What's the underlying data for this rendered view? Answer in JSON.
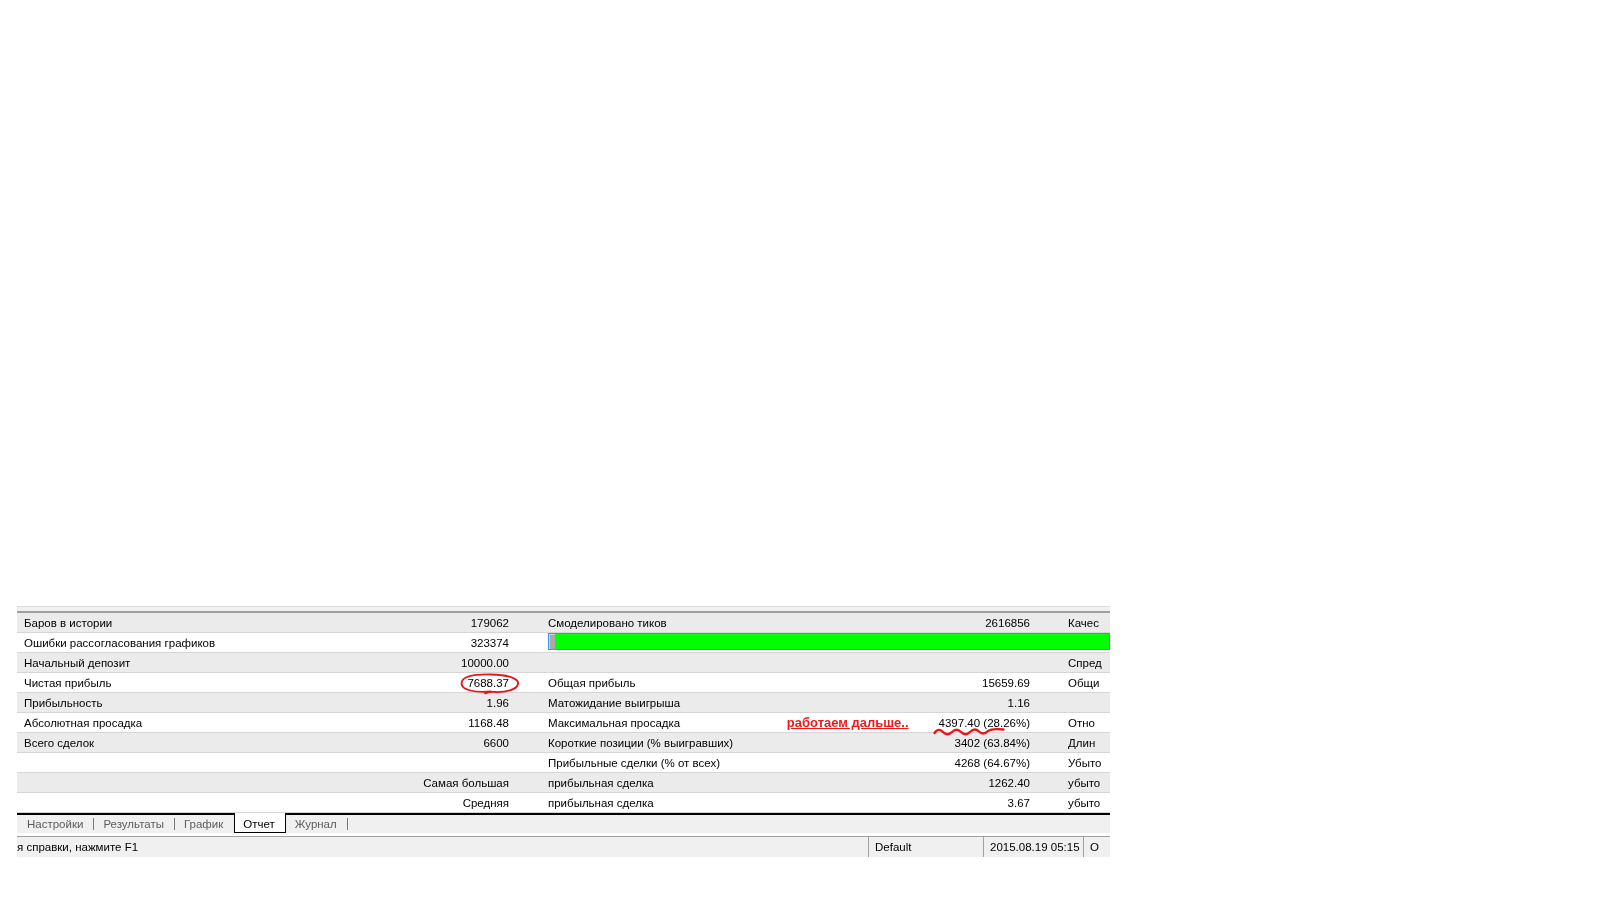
{
  "report": {
    "rows": [
      {
        "label": "Баров в истории",
        "value": "179062",
        "value_circled": false,
        "label_2": "Смоделировано тиков",
        "value_2": "2616856",
        "value_2_wavy_underline": false,
        "label_3": "Качес"
      },
      {
        "label": "Ошибки рассогласования графиков",
        "value": "323374",
        "value_circled": false,
        "value_2_wavy_underline": false,
        "quality_bar": {
          "level": 0.99
        }
      },
      {
        "label": "Начальный депозит",
        "value": "10000.00",
        "value_circled": false,
        "value_2_wavy_underline": false,
        "label_3": "Спред"
      },
      {
        "label": "Чистая прибыль",
        "value": "7688.37",
        "value_circled": true,
        "label_2": "Общая прибыль",
        "value_2": "15659.69",
        "value_2_wavy_underline": false,
        "label_3": "Общи"
      },
      {
        "label": "Прибыльность",
        "value": "1.96",
        "value_circled": false,
        "label_2": "Матожидание выигрыша",
        "value_2": "1.16",
        "value_2_wavy_underline": false
      },
      {
        "label": "Абсолютная просадка",
        "value": "1168.48",
        "value_circled": false,
        "label_2": "Максимальная просадка",
        "note": "работаем дальше..",
        "value_2": "4397.40 (28.26%)",
        "value_2_wavy_underline": true,
        "label_3": "Отно"
      },
      {
        "label": "Всего сделок",
        "value": "6600",
        "value_circled": false,
        "label_2": "Короткие позиции (% выигравших)",
        "value_2": "3402 (63.84%)",
        "value_2_wavy_underline": false,
        "label_3": "Длин"
      },
      {
        "value_circled": false,
        "label_2": "Прибыльные сделки (% от всех)",
        "value_2": "4268 (64.67%)",
        "value_2_wavy_underline": false,
        "label_3": "Убыто"
      },
      {
        "value": "Самая большая",
        "value_circled": false,
        "label_2": "прибыльная сделка",
        "value_2": "1262.40",
        "value_2_wavy_underline": false,
        "label_3": "убыто"
      },
      {
        "value": "Средняя",
        "value_circled": false,
        "label_2": "прибыльная сделка",
        "value_2": "3.67",
        "value_2_wavy_underline": false,
        "label_3": "убыто"
      }
    ]
  },
  "tabs": [
    {
      "label": "Настройки",
      "selected": false
    },
    {
      "label": "Результаты",
      "selected": false
    },
    {
      "label": "График",
      "selected": false
    },
    {
      "label": "Отчет",
      "selected": true
    },
    {
      "label": "Журнал",
      "selected": false
    }
  ],
  "status_bar": {
    "fields": [
      "я справки, нажмите F1",
      "Default",
      "2015.08.19 05:15",
      "O"
    ]
  }
}
